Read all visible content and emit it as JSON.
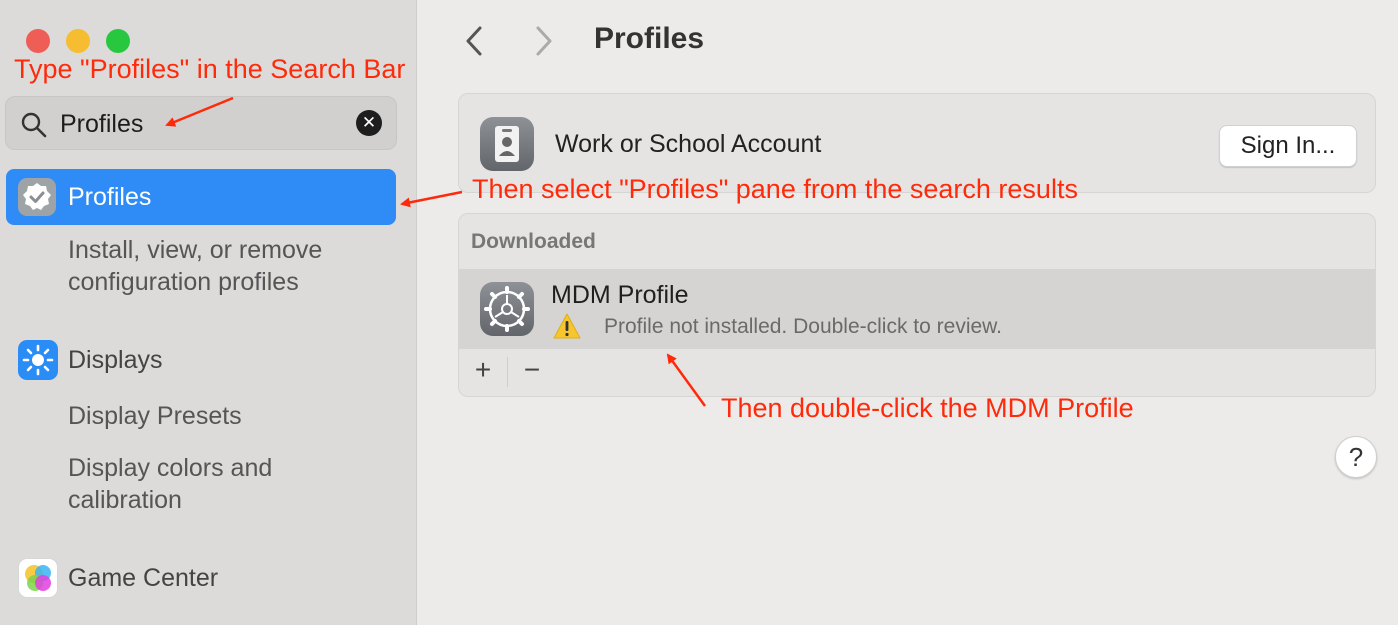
{
  "sidebar": {
    "search": {
      "value": "Profiles"
    },
    "selected_item": {
      "label": "Profiles"
    },
    "results": [
      {
        "label": "Install, view, or remove configuration profiles"
      },
      {
        "label": "Displays"
      },
      {
        "label": "Display Presets"
      },
      {
        "label": "Display colors and calibration"
      },
      {
        "label": "Game Center"
      }
    ]
  },
  "toolbar": {
    "title": "Profiles"
  },
  "work_account": {
    "label": "Work or School Account",
    "button": "Sign In..."
  },
  "downloaded": {
    "header": "Downloaded",
    "profile": {
      "name": "MDM Profile",
      "status": "Profile not installed. Double-click to review."
    },
    "add_label": "+",
    "remove_label": "−"
  },
  "help": {
    "label": "?"
  },
  "annotations": {
    "step1": "Type \"Profiles\" in the Search Bar",
    "step2": "Then select \"Profiles\" pane from the search results",
    "step3": "Then double-click the MDM Profile"
  },
  "colors": {
    "accent": "#2f8cf6",
    "annotation": "#ff2a0a",
    "close": "#ee5d56",
    "minimize": "#f5bd2f",
    "zoom": "#27c840"
  },
  "icons": {
    "profiles": "checkmark-badge-icon",
    "displays": "sun-icon",
    "game_center": "game-center-icon",
    "work_account": "id-badge-icon",
    "mdm": "gear-icon",
    "warning": "warning-icon"
  }
}
